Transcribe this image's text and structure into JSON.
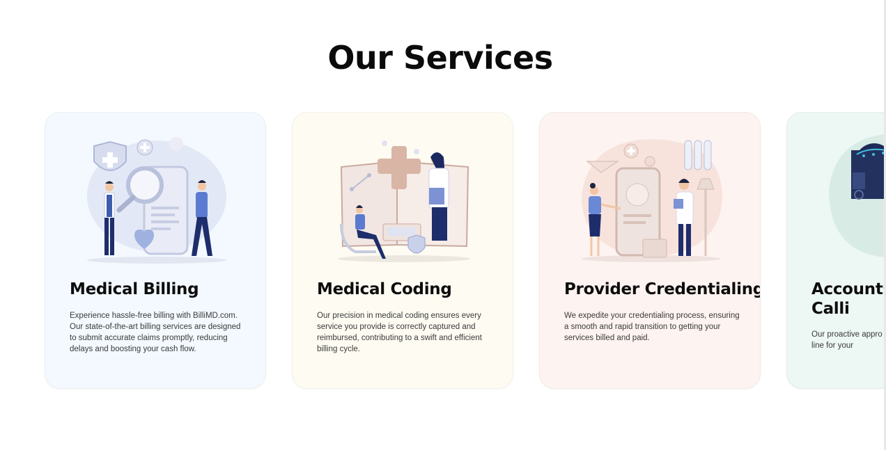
{
  "section": {
    "title": "Our Services"
  },
  "colors": {
    "accent_blue": "#3f5fae",
    "navy": "#1f2f6b",
    "card1_bg": "#f3f9fe",
    "card2_bg": "#fefbf2",
    "card3_bg": "#fdf3f0",
    "card4_bg": "#edf7f3"
  },
  "cards": [
    {
      "title": "Medical Billing",
      "description": "Experience hassle-free billing with BilliMD.com. Our state-of-the-art billing services are designed to submit accurate claims promptly, reducing delays and boosting your cash flow.",
      "icon": "medical-billing-illustration"
    },
    {
      "title": "Medical Coding",
      "description": "Our precision in medical coding ensures every service you provide is correctly captured and reimbursed, contributing to a swift and efficient billing cycle.",
      "icon": "medical-coding-illustration"
    },
    {
      "title": "Provider Credentialing",
      "description": "We expedite your credentialing process, ensuring a smooth and rapid transition to getting your services billed and paid.",
      "icon": "provider-credentialing-illustration"
    },
    {
      "title": "Accounts (AR) Calli",
      "description": "Our proactive appro faster payment reso bottom line for your",
      "icon": "accounts-receivable-illustration"
    }
  ]
}
